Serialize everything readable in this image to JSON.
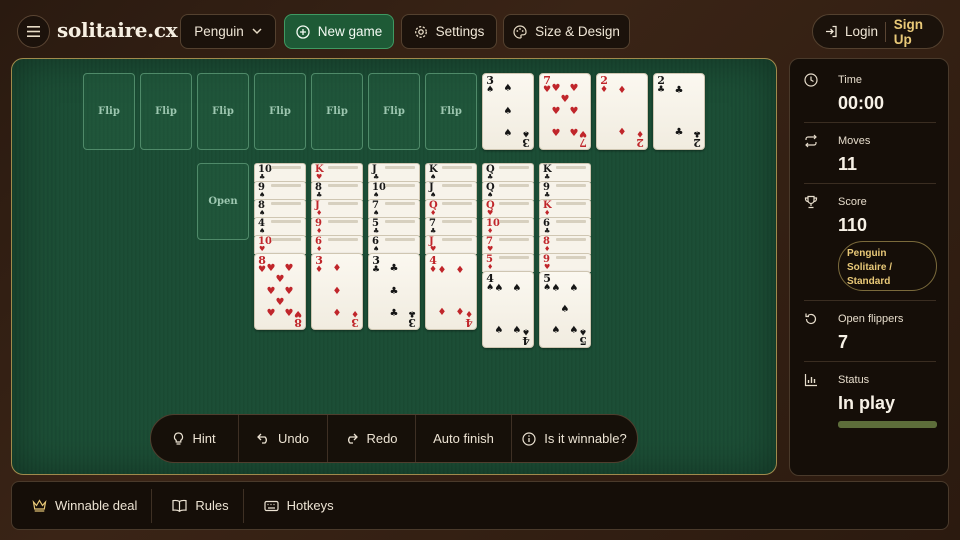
{
  "header": {
    "logo": "solitaire.cx",
    "variant": "Penguin",
    "new_game": "New game",
    "settings": "Settings",
    "size_design": "Size & Design",
    "login": "Login",
    "signup": "Sign Up"
  },
  "board": {
    "flip_label": "Flip",
    "open_label": "Open",
    "foundation": [
      {
        "rank": "3",
        "suit": "♠",
        "color": "black"
      },
      {
        "rank": "7",
        "suit": "♥",
        "color": "red"
      },
      {
        "rank": "2",
        "suit": "♦",
        "color": "red"
      },
      {
        "rank": "2",
        "suit": "♣",
        "color": "black"
      }
    ],
    "columns": [
      {
        "stack": [
          [
            "10",
            "♣",
            "black"
          ],
          [
            "9",
            "♠",
            "black"
          ],
          [
            "8",
            "♠",
            "black"
          ],
          [
            "4",
            "♠",
            "black"
          ],
          [
            "10",
            "♥",
            "red"
          ]
        ],
        "top": {
          "rank": "8",
          "suit": "♥",
          "color": "red"
        }
      },
      {
        "stack": [
          [
            "K",
            "♥",
            "red"
          ],
          [
            "8",
            "♣",
            "black"
          ],
          [
            "J",
            "♦",
            "red"
          ],
          [
            "9",
            "♦",
            "red"
          ],
          [
            "6",
            "♦",
            "red"
          ]
        ],
        "top": {
          "rank": "3",
          "suit": "♦",
          "color": "red"
        }
      },
      {
        "stack": [
          [
            "J",
            "♣",
            "black"
          ],
          [
            "10",
            "♠",
            "black"
          ],
          [
            "7",
            "♠",
            "black"
          ],
          [
            "5",
            "♣",
            "black"
          ],
          [
            "6",
            "♠",
            "black"
          ]
        ],
        "top": {
          "rank": "3",
          "suit": "♣",
          "color": "black"
        }
      },
      {
        "stack": [
          [
            "K",
            "♠",
            "black"
          ],
          [
            "J",
            "♠",
            "black"
          ],
          [
            "Q",
            "♦",
            "red"
          ],
          [
            "7",
            "♣",
            "black"
          ],
          [
            "J",
            "♥",
            "red"
          ]
        ],
        "top": {
          "rank": "4",
          "suit": "♦",
          "color": "red"
        }
      },
      {
        "stack": [
          [
            "Q",
            "♣",
            "black"
          ],
          [
            "Q",
            "♠",
            "black"
          ],
          [
            "Q",
            "♥",
            "red"
          ],
          [
            "10",
            "♦",
            "red"
          ],
          [
            "7",
            "♥",
            "red"
          ],
          [
            "5",
            "♦",
            "red"
          ]
        ],
        "top": {
          "rank": "4",
          "suit": "♠",
          "color": "black"
        }
      },
      {
        "stack": [
          [
            "K",
            "♣",
            "black"
          ],
          [
            "9",
            "♣",
            "black"
          ],
          [
            "K",
            "♦",
            "red"
          ],
          [
            "6",
            "♣",
            "black"
          ],
          [
            "8",
            "♦",
            "red"
          ],
          [
            "9",
            "♥",
            "red"
          ]
        ],
        "top": {
          "rank": "5",
          "suit": "♠",
          "color": "black"
        }
      }
    ]
  },
  "actions": {
    "hint": "Hint",
    "undo": "Undo",
    "redo": "Redo",
    "auto_finish": "Auto finish",
    "winnable": "Is it winnable?"
  },
  "panel": {
    "time_label": "Time",
    "time_value": "00:00",
    "moves_label": "Moves",
    "moves_value": "11",
    "score_label": "Score",
    "score_value": "110",
    "mode": "Penguin Solitaire / Standard",
    "flippers_label": "Open flippers",
    "flippers_value": "7",
    "status_label": "Status",
    "status_value": "In play"
  },
  "footer": {
    "winnable_deal": "Winnable deal",
    "rules": "Rules",
    "hotkeys": "Hotkeys"
  }
}
